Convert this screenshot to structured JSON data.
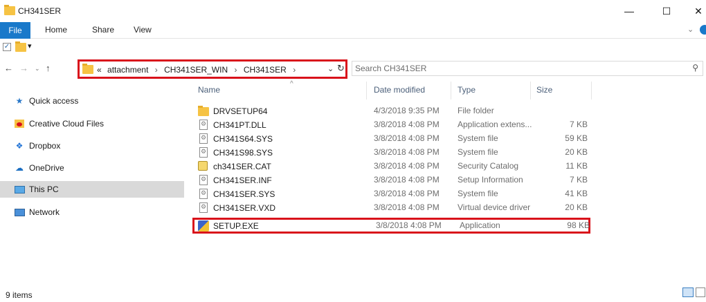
{
  "window": {
    "title": "CH341SER"
  },
  "ribbon": {
    "tabs": [
      "File",
      "Home",
      "Share",
      "View"
    ]
  },
  "address": {
    "overflow": "«",
    "crumbs": [
      "attachment",
      "CH341SER_WIN",
      "CH341SER"
    ],
    "separator": "›"
  },
  "search": {
    "placeholder": "Search CH341SER"
  },
  "navpane": {
    "items": [
      {
        "label": "Quick access",
        "icon": "star-icon"
      },
      {
        "label": "Creative Cloud Files",
        "icon": "creative-cloud-icon"
      },
      {
        "label": "Dropbox",
        "icon": "dropbox-icon"
      },
      {
        "label": "OneDrive",
        "icon": "onedrive-icon"
      },
      {
        "label": "This PC",
        "icon": "computer-icon"
      },
      {
        "label": "Network",
        "icon": "network-icon"
      }
    ]
  },
  "columns": {
    "name": "Name",
    "date": "Date modified",
    "type": "Type",
    "size": "Size"
  },
  "files": [
    {
      "name": "DRVSETUP64",
      "date": "4/3/2018 9:35 PM",
      "type": "File folder",
      "size": "",
      "icon": "folder-icon"
    },
    {
      "name": "CH341PT.DLL",
      "date": "3/8/2018 4:08 PM",
      "type": "Application extens...",
      "size": "7 KB",
      "icon": "system-file-icon"
    },
    {
      "name": "CH341S64.SYS",
      "date": "3/8/2018 4:08 PM",
      "type": "System file",
      "size": "59 KB",
      "icon": "system-file-icon"
    },
    {
      "name": "CH341S98.SYS",
      "date": "3/8/2018 4:08 PM",
      "type": "System file",
      "size": "20 KB",
      "icon": "system-file-icon"
    },
    {
      "name": "ch341SER.CAT",
      "date": "3/8/2018 4:08 PM",
      "type": "Security Catalog",
      "size": "11 KB",
      "icon": "catalog-icon"
    },
    {
      "name": "CH341SER.INF",
      "date": "3/8/2018 4:08 PM",
      "type": "Setup Information",
      "size": "7 KB",
      "icon": "setup-info-icon"
    },
    {
      "name": "CH341SER.SYS",
      "date": "3/8/2018 4:08 PM",
      "type": "System file",
      "size": "41 KB",
      "icon": "system-file-icon"
    },
    {
      "name": "CH341SER.VXD",
      "date": "3/8/2018 4:08 PM",
      "type": "Virtual device driver",
      "size": "20 KB",
      "icon": "system-file-icon"
    },
    {
      "name": "SETUP.EXE",
      "date": "3/8/2018 4:08 PM",
      "type": "Application",
      "size": "98 KB",
      "icon": "setup-exe-icon"
    }
  ],
  "status": {
    "items": "9 items"
  },
  "colors": {
    "accent": "#1979ca",
    "highlight": "#d9121b",
    "selected": "#d9d9d9"
  }
}
